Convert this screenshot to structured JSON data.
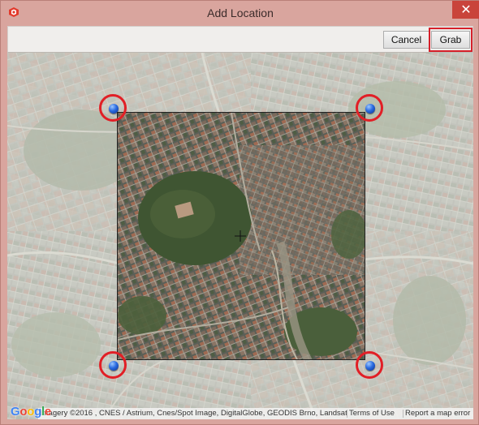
{
  "window": {
    "title": "Add Location",
    "close_glyph": "✕",
    "app_icon": "sketchup-icon"
  },
  "toolbar": {
    "cancel_label": "Cancel",
    "grab_label": "Grab"
  },
  "map": {
    "logo_letters": [
      "G",
      "o",
      "o",
      "g",
      "l",
      "e"
    ],
    "attribution": "Imagery ©2016 , CNES / Astrium, Cnes/Spot Image, DigitalGlobe, GEODIS Brno, Landsat",
    "terms_link": "Terms of Use",
    "report_link": "Report a map error"
  },
  "colors": {
    "highlight": "#e11f26",
    "pin": "#2a6be0"
  }
}
